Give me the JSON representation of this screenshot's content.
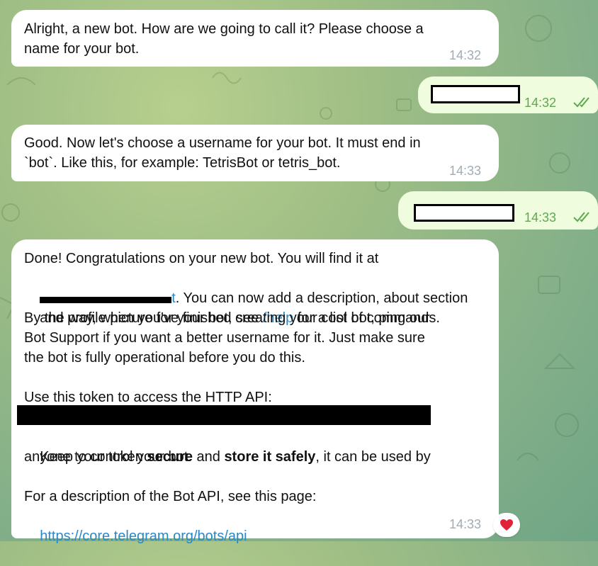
{
  "messages": {
    "m1": {
      "text": "Alright, a new bot. How are we going to call it? Please choose a name for your bot.",
      "time": "14:32"
    },
    "m2": {
      "time": "14:32"
    },
    "m3": {
      "line1": "Good. Now let's choose a username for your bot. It must end in",
      "line2": "`bot`. Like this, for example: TetrisBot or tetris_bot.",
      "time": "14:33"
    },
    "m4": {
      "time": "14:33"
    },
    "m5": {
      "intro": "Done! Congratulations on your new bot. You will find it at",
      "link_tail": "t",
      "after_link": ". You can now add a description, about section",
      "line3_a": "and profile picture for your bot, see ",
      "help": "/help",
      "line3_b": " for a list of commands.",
      "line4": "By the way, when you've finished creating your cool bot, ping our",
      "line5": "Bot Support if you want a better username for it. Just make sure",
      "line6": "the bot is fully operational before you do this.",
      "token_label": "Use this token to access the HTTP API:",
      "keep_1": "Keep your token ",
      "keep_secure": "secure",
      "keep_2": " and ",
      "keep_store": "store it safely",
      "keep_3": ", it can be used by",
      "keep_line2": "anyone to control your bot.",
      "api_desc": "For a description of the Bot API, see this page:",
      "api_link": "https://core.telegram.org/bots/api",
      "time": "14:33"
    }
  },
  "reaction": {
    "emoji": "❤️",
    "icon": "heart-icon"
  },
  "colors": {
    "incoming_bubble": "#ffffff",
    "outgoing_bubble": "#effdde",
    "link": "#2a88c8",
    "outgoing_time": "#5fa84f",
    "incoming_time": "#a0acb6"
  }
}
